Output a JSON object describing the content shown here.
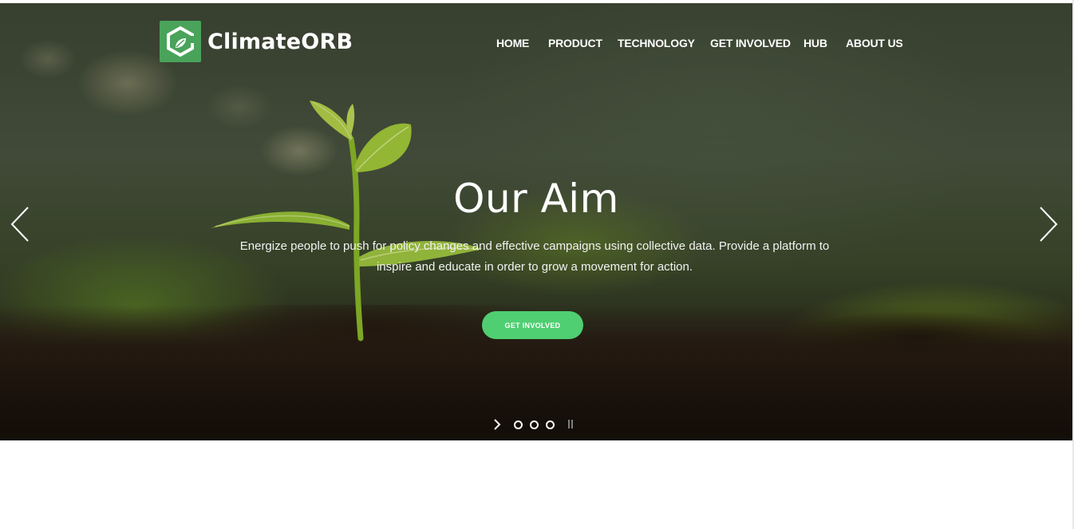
{
  "brand": {
    "name": "ClimateORB",
    "colors": {
      "accent": "#4fcf71",
      "logo_bg": "#4aa35a"
    }
  },
  "nav": {
    "items": [
      {
        "label": "HOME"
      },
      {
        "label": "PRODUCT"
      },
      {
        "label": "TECHNOLOGY"
      },
      {
        "label": "GET INVOLVED"
      },
      {
        "label": "HUB"
      },
      {
        "label": "ABOUT US"
      }
    ]
  },
  "hero": {
    "title": "Our Aim",
    "description": "Energize people to push for policy changes and effective campaigns using collective data. Provide a platform to inspire and educate in order to grow a movement for action.",
    "cta_label": "GET INVOLVED",
    "prev_icon": "chevron-left-icon",
    "next_icon": "chevron-right-icon",
    "slider": {
      "slide_count": 3,
      "controls": [
        "play-icon",
        "pause-icon"
      ]
    }
  }
}
